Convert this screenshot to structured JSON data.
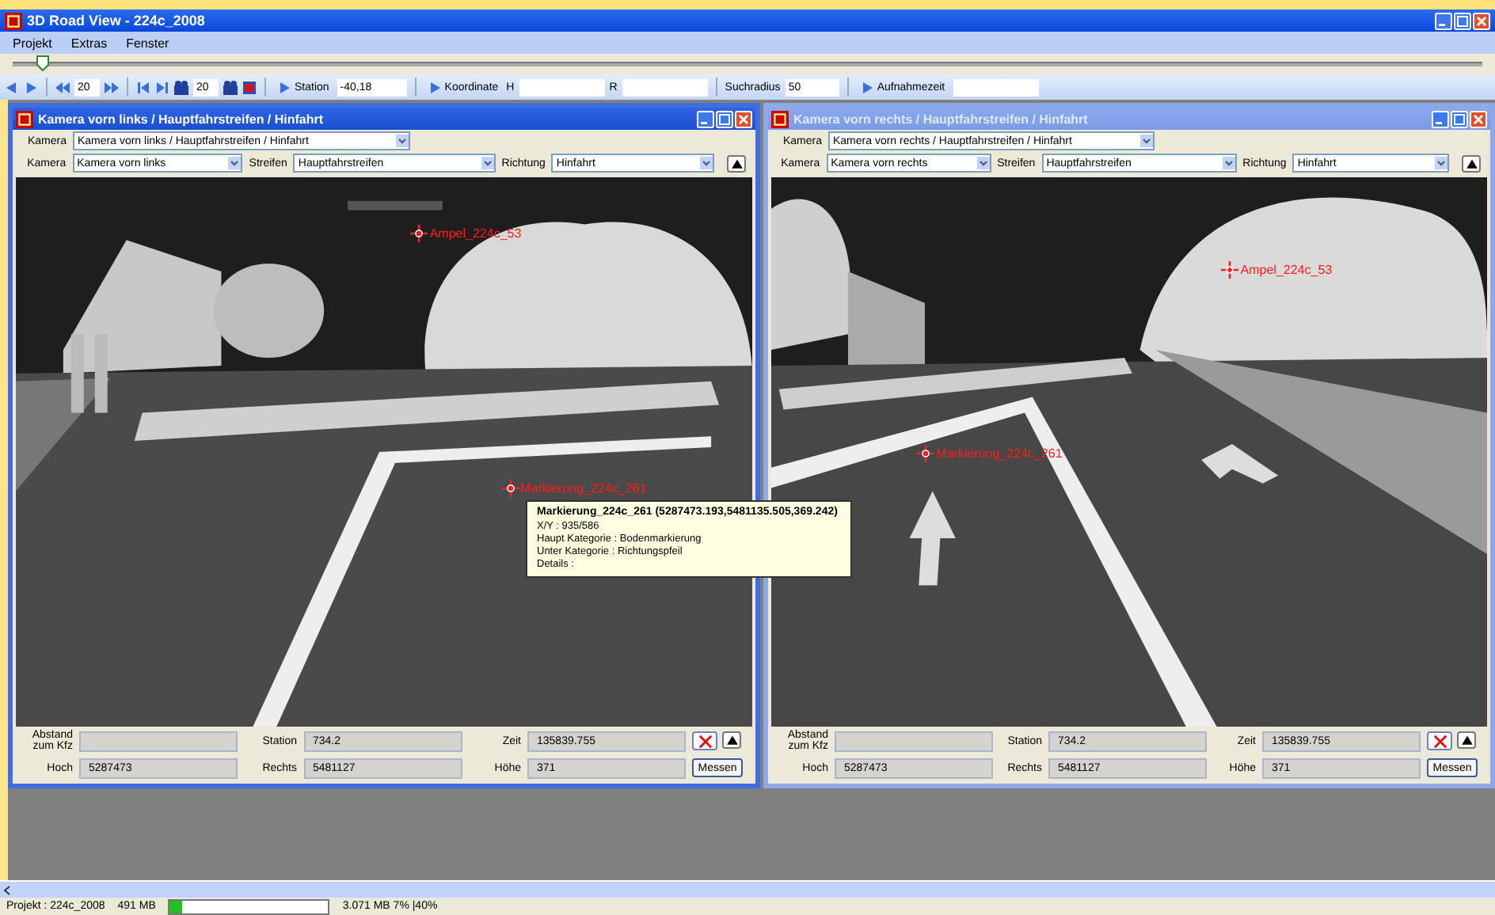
{
  "window": {
    "title": "3D Road View - 224c_2008"
  },
  "menu": [
    {
      "label": "Projekt"
    },
    {
      "label": "Extras"
    },
    {
      "label": "Fenster"
    }
  ],
  "timeline": {
    "level": 0.02
  },
  "toolbar": {
    "skip_count": "20",
    "frame_count": "20",
    "station_button": "Station",
    "station_value": "-40,18",
    "koordinate_button": "Koordinate",
    "h_label": "H",
    "r_label": "R",
    "suchradius_label": "Suchradius",
    "suchradius_value": "50",
    "aufnahmezeit_button": "Aufnahmezeit"
  },
  "panels": [
    {
      "title": "Kamera vorn links / Hauptfahrstreifen / Hinfahrt",
      "active": true,
      "path_label": "Kamera",
      "path_value": "Kamera vorn links / Hauptfahrstreifen / Hinfahrt",
      "selectors": [
        {
          "label": "Kamera",
          "value": "Kamera vorn links"
        },
        {
          "label": "Streifen",
          "value": "Hauptfahrstreifen"
        },
        {
          "label": "Richtung",
          "value": "Hinfahrt"
        }
      ],
      "markers": [
        {
          "label": "Ampel_224c_53"
        },
        {
          "label": "Markierung_224c_261"
        }
      ],
      "readouts": [
        {
          "label": "Abstand zum Kfz"
        },
        {
          "label": "Station",
          "value": "734.2"
        },
        {
          "label": "Zeit",
          "value": "135839.755"
        },
        {
          "label": "Hoch",
          "value": "5287473"
        },
        {
          "label": "Rechts",
          "value": "5481127"
        },
        {
          "label": "Höhe",
          "value": "371"
        }
      ],
      "measure_button": "Messen",
      "tooltip": {
        "title": "Markierung_224c_261 (5287473.193,5481135.505,369.242)",
        "lines": [
          "X/Y : 935/586",
          "Haupt Kategorie : Bodenmarkierung",
          "Unter Kategorie : Richtungspfeil",
          "Details :"
        ]
      }
    },
    {
      "title": "Kamera vorn rechts / Hauptfahrstreifen / Hinfahrt",
      "active": false,
      "path_label": "Kamera",
      "path_value": "Kamera vorn rechts / Hauptfahrstreifen / Hinfahrt",
      "selectors": [
        {
          "label": "Kamera",
          "value": "Kamera vorn rechts"
        },
        {
          "label": "Streifen",
          "value": "Hauptfahrstreifen"
        },
        {
          "label": "Richtung",
          "value": "Hinfahrt"
        }
      ],
      "markers": [
        {
          "label": "Ampel_224c_53"
        },
        {
          "label": "Markierung_224c_261"
        }
      ],
      "readouts": [
        {
          "label": "Abstand zum Kfz"
        },
        {
          "label": "Station",
          "value": "734.2"
        },
        {
          "label": "Zeit",
          "value": "135839.755"
        },
        {
          "label": "Hoch",
          "value": "5287473"
        },
        {
          "label": "Rechts",
          "value": "5481127"
        },
        {
          "label": "Höhe",
          "value": "371"
        }
      ],
      "measure_button": "Messen"
    }
  ],
  "status_bar": {
    "project": "Projekt : 224c_2008",
    "memory": "491 MB",
    "level": 0.08,
    "info": "3.071 MB  7% |40%"
  }
}
